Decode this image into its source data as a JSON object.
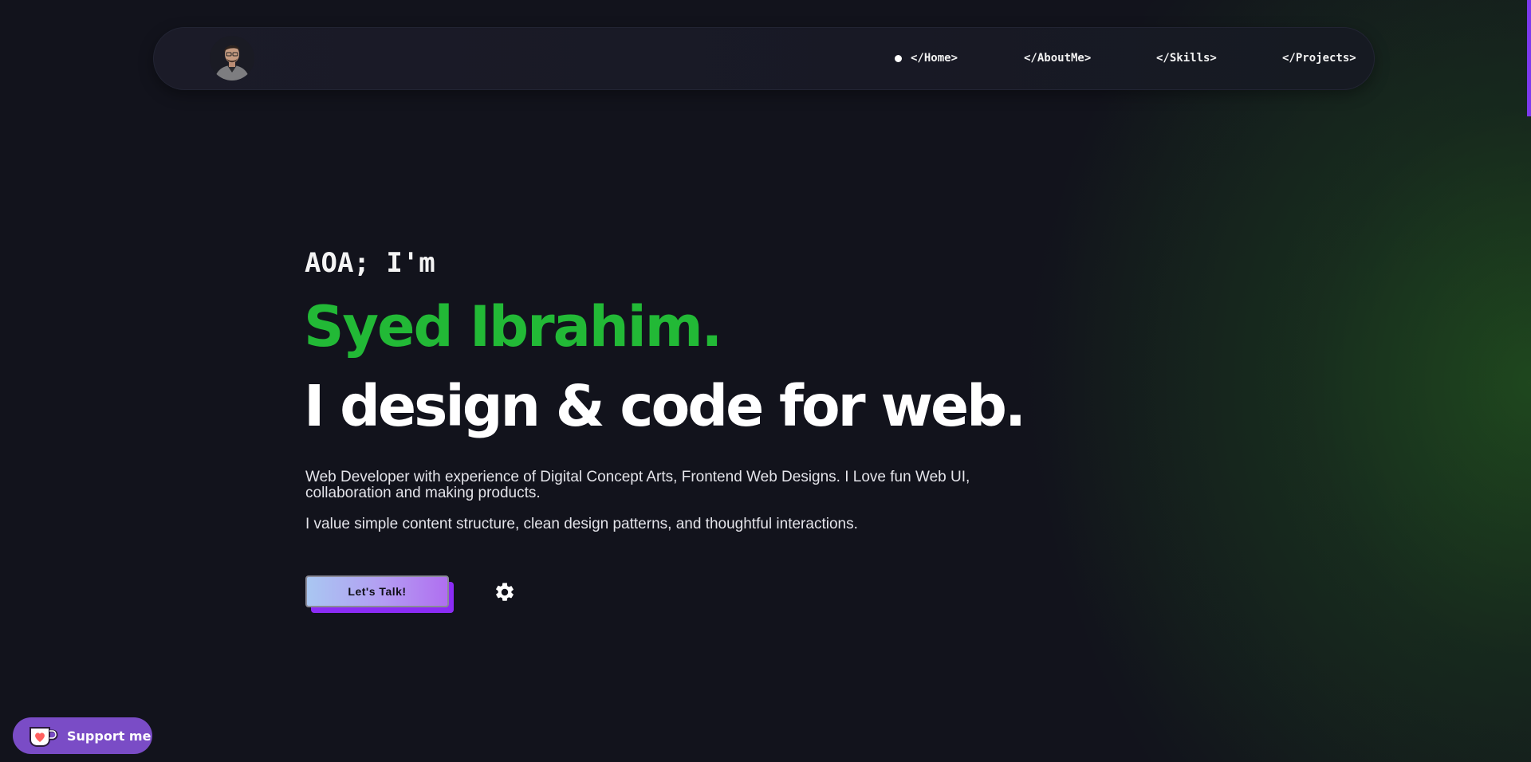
{
  "nav": {
    "avatar_icon": "profile-photo",
    "items": [
      {
        "label": "</Home>",
        "active": true
      },
      {
        "label": "</AboutMe>",
        "active": false
      },
      {
        "label": "</Skills>",
        "active": false
      },
      {
        "label": "</Projects>",
        "active": false
      }
    ]
  },
  "hero": {
    "greeting": "AOA; I'm",
    "name": "Syed Ibrahim.",
    "tagline": "I design & code for web.",
    "description_1": "Web Developer with experience of Digital Concept Arts, Frontend Web Designs. I Love fun Web UI, collaboration and making products.",
    "description_2": "I value simple content structure, clean design patterns, and thoughtful interactions.",
    "cta_label": "Let's Talk!",
    "settings_icon": "gear-icon"
  },
  "support": {
    "label": "Support me",
    "icon": "ko-fi-cup-icon"
  },
  "colors": {
    "background": "#12131c",
    "name_accent": "#22b936",
    "cta_shadow": "#8b2cf5",
    "support_bg": "#7a4cc6",
    "scroll_indicator": "#7c3aed",
    "glow": "#22541e"
  }
}
